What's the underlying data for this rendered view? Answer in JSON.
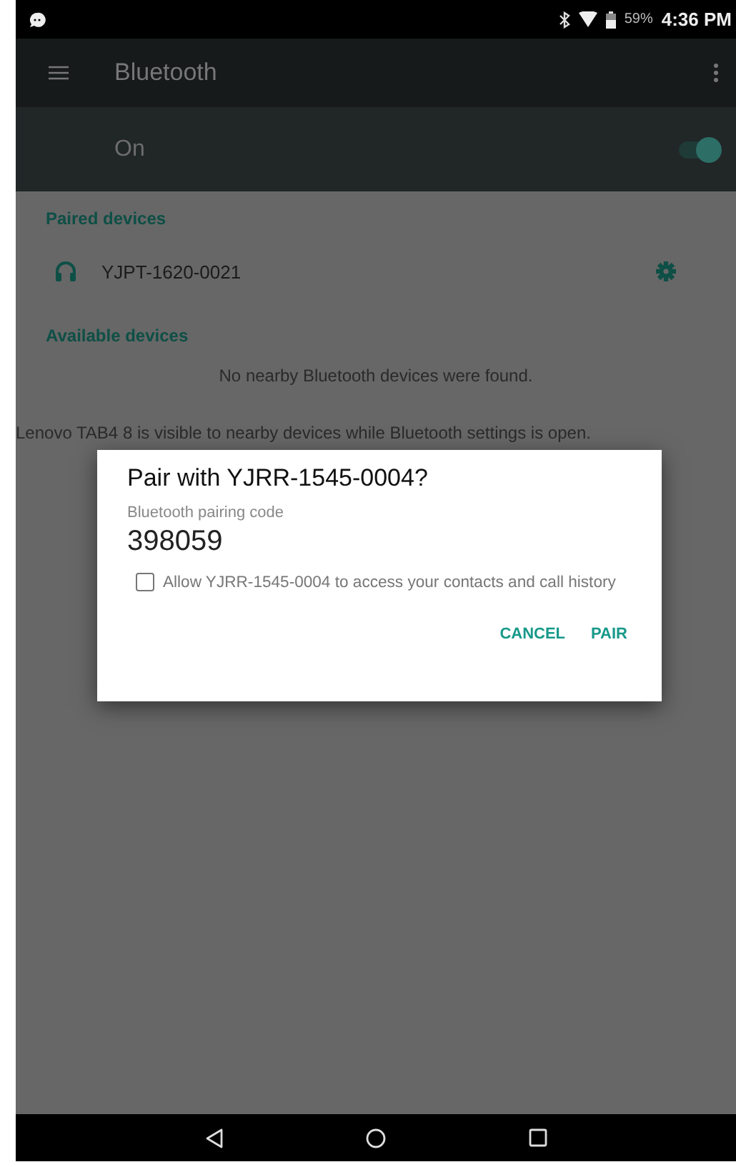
{
  "status_bar": {
    "battery": "59%",
    "time": "4:36 PM"
  },
  "toolbar": {
    "title": "Bluetooth"
  },
  "master_switch": {
    "label": "On",
    "on": true
  },
  "paired": {
    "header": "Paired devices",
    "devices": [
      {
        "name": "YJPT-1620-0021"
      }
    ]
  },
  "available": {
    "header": "Available devices",
    "empty_message": "No nearby Bluetooth devices were found."
  },
  "visibility_note": "Lenovo TAB4 8 is visible to nearby devices while Bluetooth settings is open.",
  "dialog": {
    "title": "Pair with YJRR-1545-0004?",
    "code_label": "Bluetooth pairing code",
    "code": "398059",
    "checkbox": {
      "label": "Allow YJRR-1545-0004 to access your contacts and call history",
      "checked": false
    },
    "buttons": [
      "CANCEL",
      "PAIR"
    ]
  }
}
